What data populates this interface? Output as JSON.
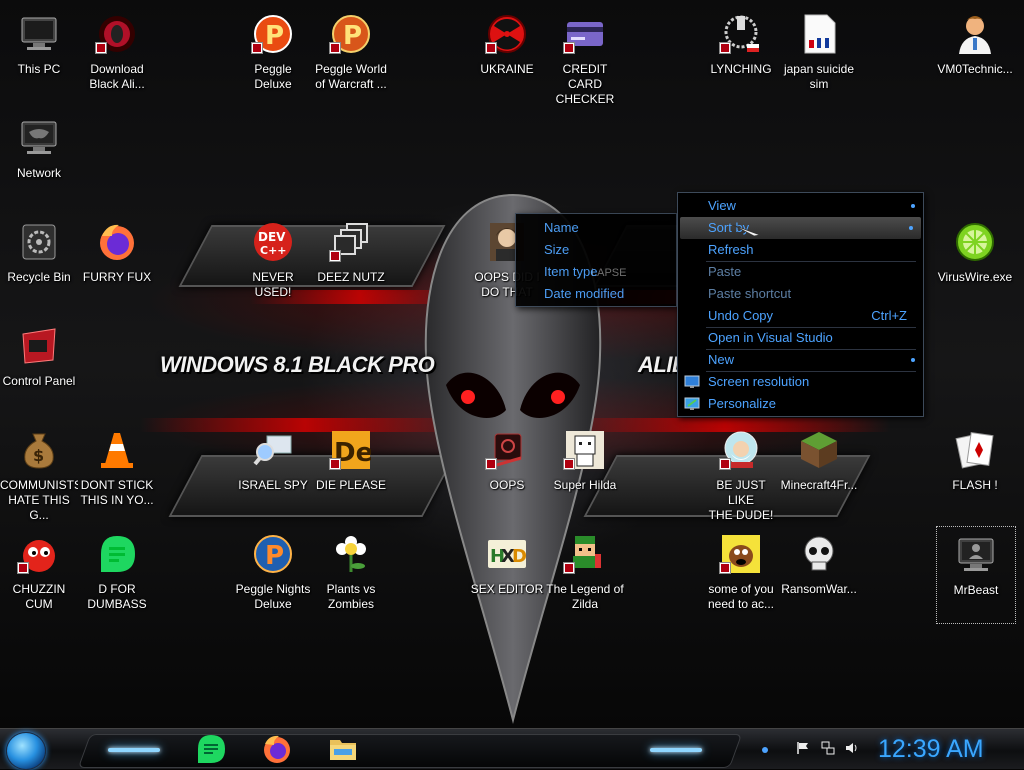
{
  "desktop": {
    "wallpaper_text_left": "WINDOWS 8.1 BLACK PRO",
    "wallpaper_text_right": "ALIE",
    "icons": [
      {
        "label": "This PC",
        "icon": "computer-icon"
      },
      {
        "label": "Download\nBlack Ali...",
        "icon": "alienware-logo-icon"
      },
      {
        "label": "Peggle Deluxe",
        "icon": "peggle-icon"
      },
      {
        "label": "Peggle World\nof Warcraft ...",
        "icon": "peggle-icon"
      },
      {
        "label": "UKRAINE",
        "icon": "radiation-icon"
      },
      {
        "label": "CREDIT CARD\nCHECKER",
        "icon": "credit-card-icon"
      },
      {
        "label": "LYNCHING",
        "icon": "zipper-icon"
      },
      {
        "label": "japan suicide\nsim",
        "icon": "document-icon"
      },
      {
        "label": "VM0Technic...",
        "icon": "doctor-icon"
      },
      {
        "label": "Network",
        "icon": "network-icon"
      },
      {
        "label": "Recycle Bin",
        "icon": "recycle-bin-icon"
      },
      {
        "label": "FURRY FUX",
        "icon": "firefox-icon"
      },
      {
        "label": "NEVER USED!",
        "icon": "devcpp-icon"
      },
      {
        "label": "DEEZ NUTZ",
        "icon": "windows-stack-icon"
      },
      {
        "label": "OOPS DID I\nDO THAT",
        "icon": "portrait-icon"
      },
      {
        "label": "VirusWire.exe",
        "icon": "limewire-icon"
      },
      {
        "label": "Control Panel",
        "icon": "control-panel-icon"
      },
      {
        "label": "COMMUNISTS\nHATE THIS G...",
        "icon": "money-bag-icon"
      },
      {
        "label": "DONT STICK\nTHIS IN YO...",
        "icon": "traffic-cone-icon"
      },
      {
        "label": "ISRAEL SPY",
        "icon": "magnifier-computer-icon"
      },
      {
        "label": "DIE PLEASE",
        "icon": "de-icon"
      },
      {
        "label": "OOPS",
        "icon": "oops-icon"
      },
      {
        "label": "Super Hilda",
        "icon": "pixel-character-icon"
      },
      {
        "label": "BE JUST LIKE\nTHE DUDE!",
        "icon": "snow-globe-icon"
      },
      {
        "label": "Minecraft4Fr...",
        "icon": "grass-block-icon"
      },
      {
        "label": "FLASH !",
        "icon": "playing-cards-icon"
      },
      {
        "label": "CHUZZIN\nCUM",
        "icon": "chuzzle-icon"
      },
      {
        "label": "D FOR\nDUMBASS",
        "icon": "chat-bubble-icon"
      },
      {
        "label": "Peggle Nights\nDeluxe",
        "icon": "peggle-icon"
      },
      {
        "label": "Plants vs\nZombies",
        "icon": "flower-icon"
      },
      {
        "label": "SEX EDITOR",
        "icon": "hxd-icon"
      },
      {
        "label": "The Legend of\nZilda",
        "icon": "pixel-hero-icon"
      },
      {
        "label": "some of you\nneed to ac...",
        "icon": "dog-icon"
      },
      {
        "label": "RansomWar...",
        "icon": "skull-icon"
      },
      {
        "label": "MrBeast",
        "icon": "computer-user-icon"
      }
    ]
  },
  "sort_submenu": {
    "items": [
      "Name",
      "Size",
      "Item type",
      "Date modified"
    ],
    "hidden_behind_text": "LAPSE"
  },
  "context_menu": {
    "items": [
      {
        "label": "View",
        "submenu": true
      },
      {
        "label": "Sort by",
        "submenu": true,
        "highlighted": true
      },
      {
        "label": "Refresh"
      },
      {
        "label": "Paste",
        "disabled": true
      },
      {
        "label": "Paste shortcut",
        "disabled": true
      },
      {
        "label": "Undo Copy",
        "shortcut": "Ctrl+Z"
      },
      {
        "label": "Open in Visual Studio"
      },
      {
        "label": "New",
        "submenu": true
      },
      {
        "label": "Screen resolution",
        "icon": "monitor-icon"
      },
      {
        "label": "Personalize",
        "icon": "personalize-icon"
      }
    ]
  },
  "taskbar": {
    "pinned": [
      "chat-bubble-icon",
      "firefox-icon",
      "file-explorer-icon"
    ],
    "tray": [
      "flag-icon",
      "network-icon",
      "volume-icon"
    ],
    "clock": "12:39 AM"
  },
  "colors": {
    "menu_text": "#4da3ff",
    "menu_disabled": "#5d7fa4",
    "clock": "#3aa7ff",
    "accent_red": "#d40000"
  }
}
